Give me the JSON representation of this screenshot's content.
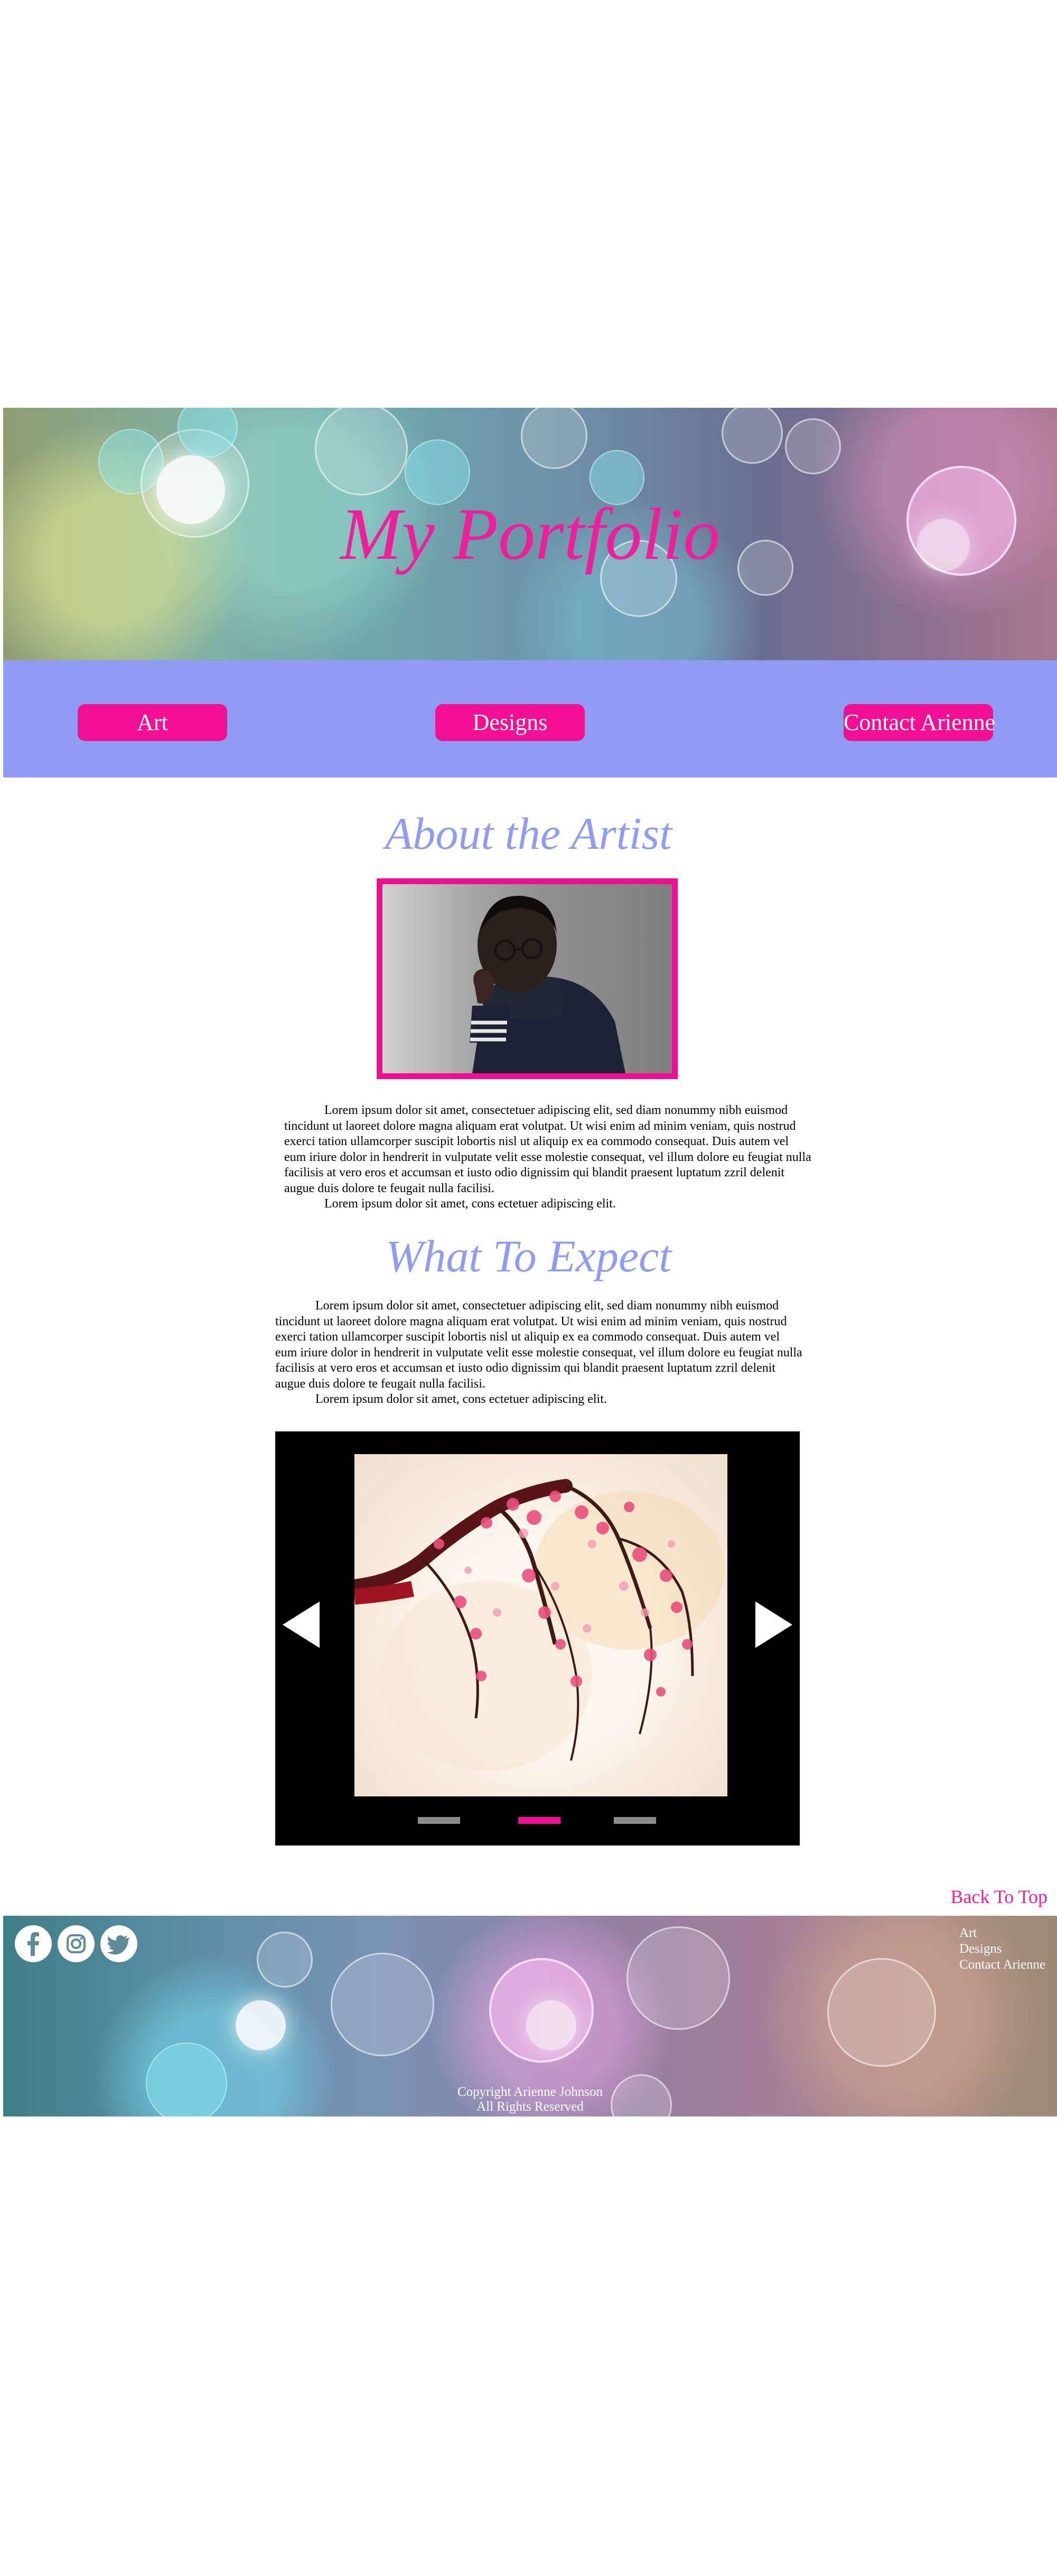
{
  "header": {
    "title": "My Portfolio"
  },
  "nav": {
    "items": [
      {
        "label": "Art"
      },
      {
        "label": "Designs"
      },
      {
        "label": "Contact Arienne"
      }
    ]
  },
  "about": {
    "title": "About the Artist",
    "paragraphs": [
      "Lorem ipsum dolor sit amet, consectetuer adipiscing elit, sed diam nonummy nibh euismod tincidunt ut laoreet dolore magna aliquam erat volutpat. Ut wisi enim ad minim veniam, quis nostrud exerci tation ullamcorper suscipit lobortis nisl ut aliquip ex ea commodo consequat. Duis autem vel eum iriure dolor in hendrerit in vulputate velit esse molestie consequat, vel illum dolore eu feugiat nulla facilisis at vero eros et accumsan et iusto odio dignissim qui blandit praesent luptatum zzril delenit augue duis dolore te feugait nulla facilisi.",
      "Lorem ipsum dolor sit amet, cons ectetuer adipiscing elit."
    ]
  },
  "expect": {
    "title": "What To Expect",
    "paragraphs": [
      "Lorem ipsum dolor sit amet, consectetuer adipiscing elit, sed diam nonummy nibh euismod tincidunt ut laoreet dolore magna aliquam erat volutpat. Ut wisi enim ad minim veniam, quis nostrud exerci tation ullamcorper suscipit lobortis nisl ut aliquip ex ea commodo consequat. Duis autem vel eum iriure dolor in hendrerit in vulputate velit esse molestie consequat, vel illum dolore eu feugiat nulla facilisis at vero eros et accumsan et iusto odio dignissim qui blandit praesent luptatum zzril delenit augue duis dolore te feugait nulla facilisi.",
      "Lorem ipsum dolor sit amet, cons ectetuer adipiscing elit."
    ]
  },
  "carousel": {
    "slide_count": 3,
    "active_index": 1,
    "active_color": "#f20f93",
    "inactive_color": "#8c8c8c"
  },
  "back_to_top": "Back To Top",
  "footer": {
    "social": [
      "facebook-icon",
      "instagram-icon",
      "twitter-icon"
    ],
    "links": [
      "Art",
      "Designs",
      "Contact Arienne"
    ],
    "copyright_line1": "Copyright Arienne Johnson",
    "copyright_line2": "All Rights Reserved"
  },
  "colors": {
    "accent_pink": "#f20f93",
    "nav_periwinkle": "#8f9cf2",
    "title_pink": "#ee1f9a"
  }
}
